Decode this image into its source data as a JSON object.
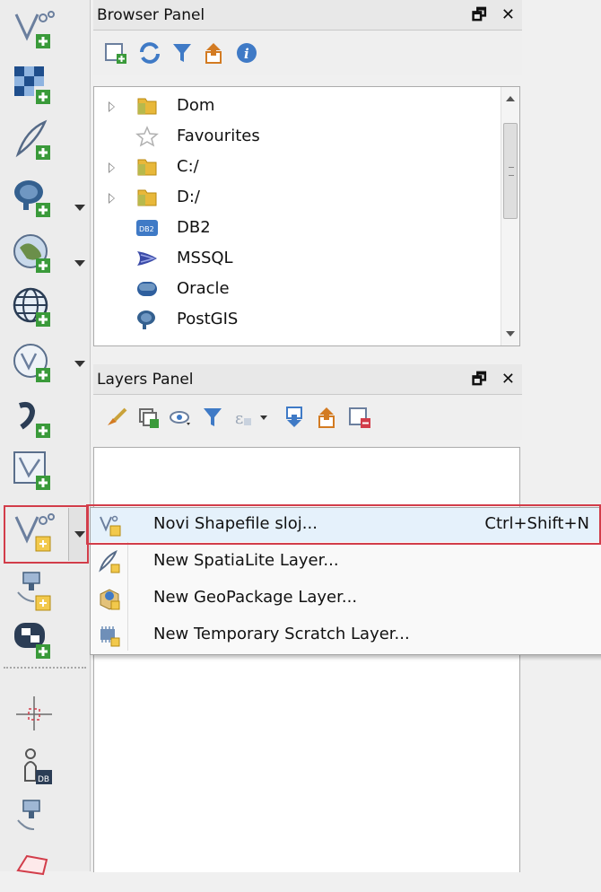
{
  "toolbar": {
    "buttons": [
      {
        "name": "new-vector-layer-icon",
        "dropdown": false
      },
      {
        "name": "new-raster-layer-icon",
        "dropdown": false
      },
      {
        "name": "new-spatialite-layer-icon",
        "dropdown": false
      },
      {
        "name": "postgis-layer-icon",
        "dropdown": true
      },
      {
        "name": "wms-layer-icon",
        "dropdown": true
      },
      {
        "name": "wcs-layer-icon",
        "dropdown": false
      },
      {
        "name": "wfs-layer-icon",
        "dropdown": true
      },
      {
        "name": "delimited-text-layer-icon",
        "dropdown": false
      },
      {
        "name": "virtual-layer-icon",
        "dropdown": false
      },
      {
        "name": "new-shapefile-layer-icon",
        "dropdown": true
      },
      {
        "name": "gps-tool-icon",
        "dropdown": false
      },
      {
        "name": "add-wms-tile-icon",
        "dropdown": false
      },
      {
        "name": "crosshair-icon",
        "dropdown": false
      },
      {
        "name": "digitizing-node-icon",
        "dropdown": false
      },
      {
        "name": "gps-receiver-icon",
        "dropdown": false
      },
      {
        "name": "polygon-edit-icon",
        "dropdown": false
      }
    ]
  },
  "browser_panel": {
    "title": "Browser Panel",
    "float_glyph": "🗗",
    "close_glyph": "✕",
    "tools": [
      "add-layer-icon",
      "refresh-icon",
      "filter-icon",
      "collapse-all-icon",
      "info-icon"
    ],
    "items": [
      {
        "label": "Dom",
        "icon": "folder-icon",
        "expandable": true
      },
      {
        "label": "Favourites",
        "icon": "star-icon",
        "expandable": false
      },
      {
        "label": "C:/",
        "icon": "folder-icon",
        "expandable": true
      },
      {
        "label": "D:/",
        "icon": "folder-icon",
        "expandable": true
      },
      {
        "label": "DB2",
        "icon": "db2-icon",
        "expandable": false,
        "badge": "DB2"
      },
      {
        "label": "MSSQL",
        "icon": "mssql-icon",
        "expandable": false
      },
      {
        "label": "Oracle",
        "icon": "oracle-icon",
        "expandable": false
      },
      {
        "label": "PostGIS",
        "icon": "postgis-icon",
        "expandable": false
      }
    ]
  },
  "layers_panel": {
    "title": "Layers Panel",
    "float_glyph": "🗗",
    "close_glyph": "✕",
    "tools": [
      "style-icon",
      "add-group-icon",
      "visibility-icon",
      "filter-icon",
      "filter-expression-icon",
      "expand-all-icon",
      "collapse-all-icon",
      "remove-layer-icon"
    ]
  },
  "context_menu": {
    "items": [
      {
        "label": "Novi Shapefile sloj...",
        "shortcut": "Ctrl+Shift+N",
        "icon": "new-shapefile-icon",
        "highlighted": true
      },
      {
        "label": "New SpatiaLite Layer...",
        "shortcut": "",
        "icon": "spatialite-icon",
        "highlighted": false
      },
      {
        "label": "New GeoPackage Layer...",
        "shortcut": "",
        "icon": "geopackage-icon",
        "highlighted": false
      },
      {
        "label": "New Temporary Scratch Layer...",
        "shortcut": "",
        "icon": "scratch-layer-icon",
        "highlighted": false
      }
    ]
  },
  "colors": {
    "highlight_outline": "#d23d4a",
    "menu_hover": "#e5f1fb",
    "plus_badge": "#3a9a3a",
    "icon_blue": "#2a5ea8",
    "folder_yellow": "#e8b83a"
  }
}
